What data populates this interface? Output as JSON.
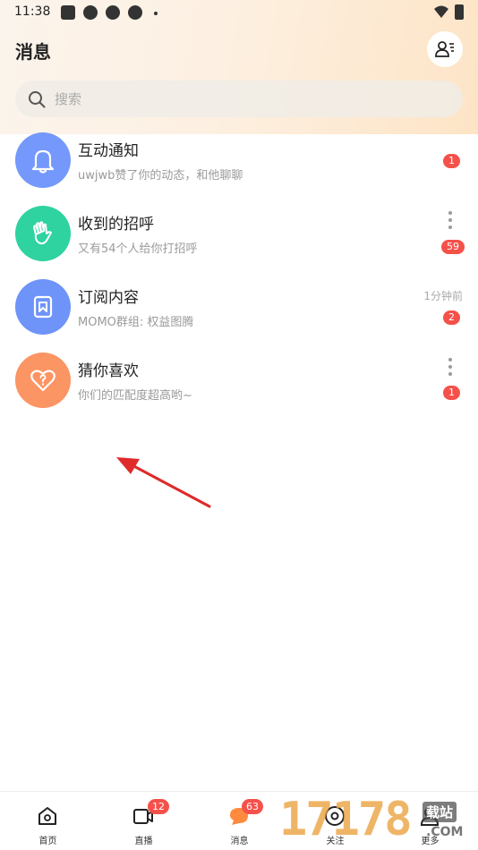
{
  "status_bar": {
    "time": "11:38"
  },
  "header": {
    "title": "消息"
  },
  "search": {
    "placeholder": "搜索"
  },
  "messages": [
    {
      "title": "互动通知",
      "subtitle": "uwjwb赞了你的动态，和他聊聊",
      "badge": "1",
      "time": "",
      "color": "#7498fb",
      "icon": "bell-icon"
    },
    {
      "title": "收到的招呼",
      "subtitle": "又有54个人给你打招呼",
      "badge": "59",
      "time": "",
      "color": "#2ed3a0",
      "icon": "hand-wave-icon"
    },
    {
      "title": "订阅内容",
      "subtitle": "MOMO群组: 权益图腾",
      "badge": "2",
      "time": "1分钟前",
      "color": "#6e94f9",
      "icon": "bookmark-icon"
    },
    {
      "title": "猜你喜欢",
      "subtitle": "你们的匹配度超高哟~",
      "badge": "1",
      "time": "",
      "color": "#fb9564",
      "icon": "heart-question-icon"
    }
  ],
  "tabs": [
    {
      "label": "首页",
      "badge": "",
      "icon": "home-icon"
    },
    {
      "label": "直播",
      "badge": "12",
      "icon": "video-icon"
    },
    {
      "label": "消息",
      "badge": "63",
      "icon": "chat-icon"
    },
    {
      "label": "关注",
      "badge": "",
      "icon": "eye-icon"
    },
    {
      "label": "更多",
      "badge": "",
      "icon": "person-icon"
    }
  ],
  "watermark": {
    "number": "17178",
    "site": "载站",
    "domain": ".COM"
  },
  "colors": {
    "accent_orange": "#ff8a3d",
    "badge_red": "#f4514a",
    "arrow_red": "#e02a2a"
  }
}
